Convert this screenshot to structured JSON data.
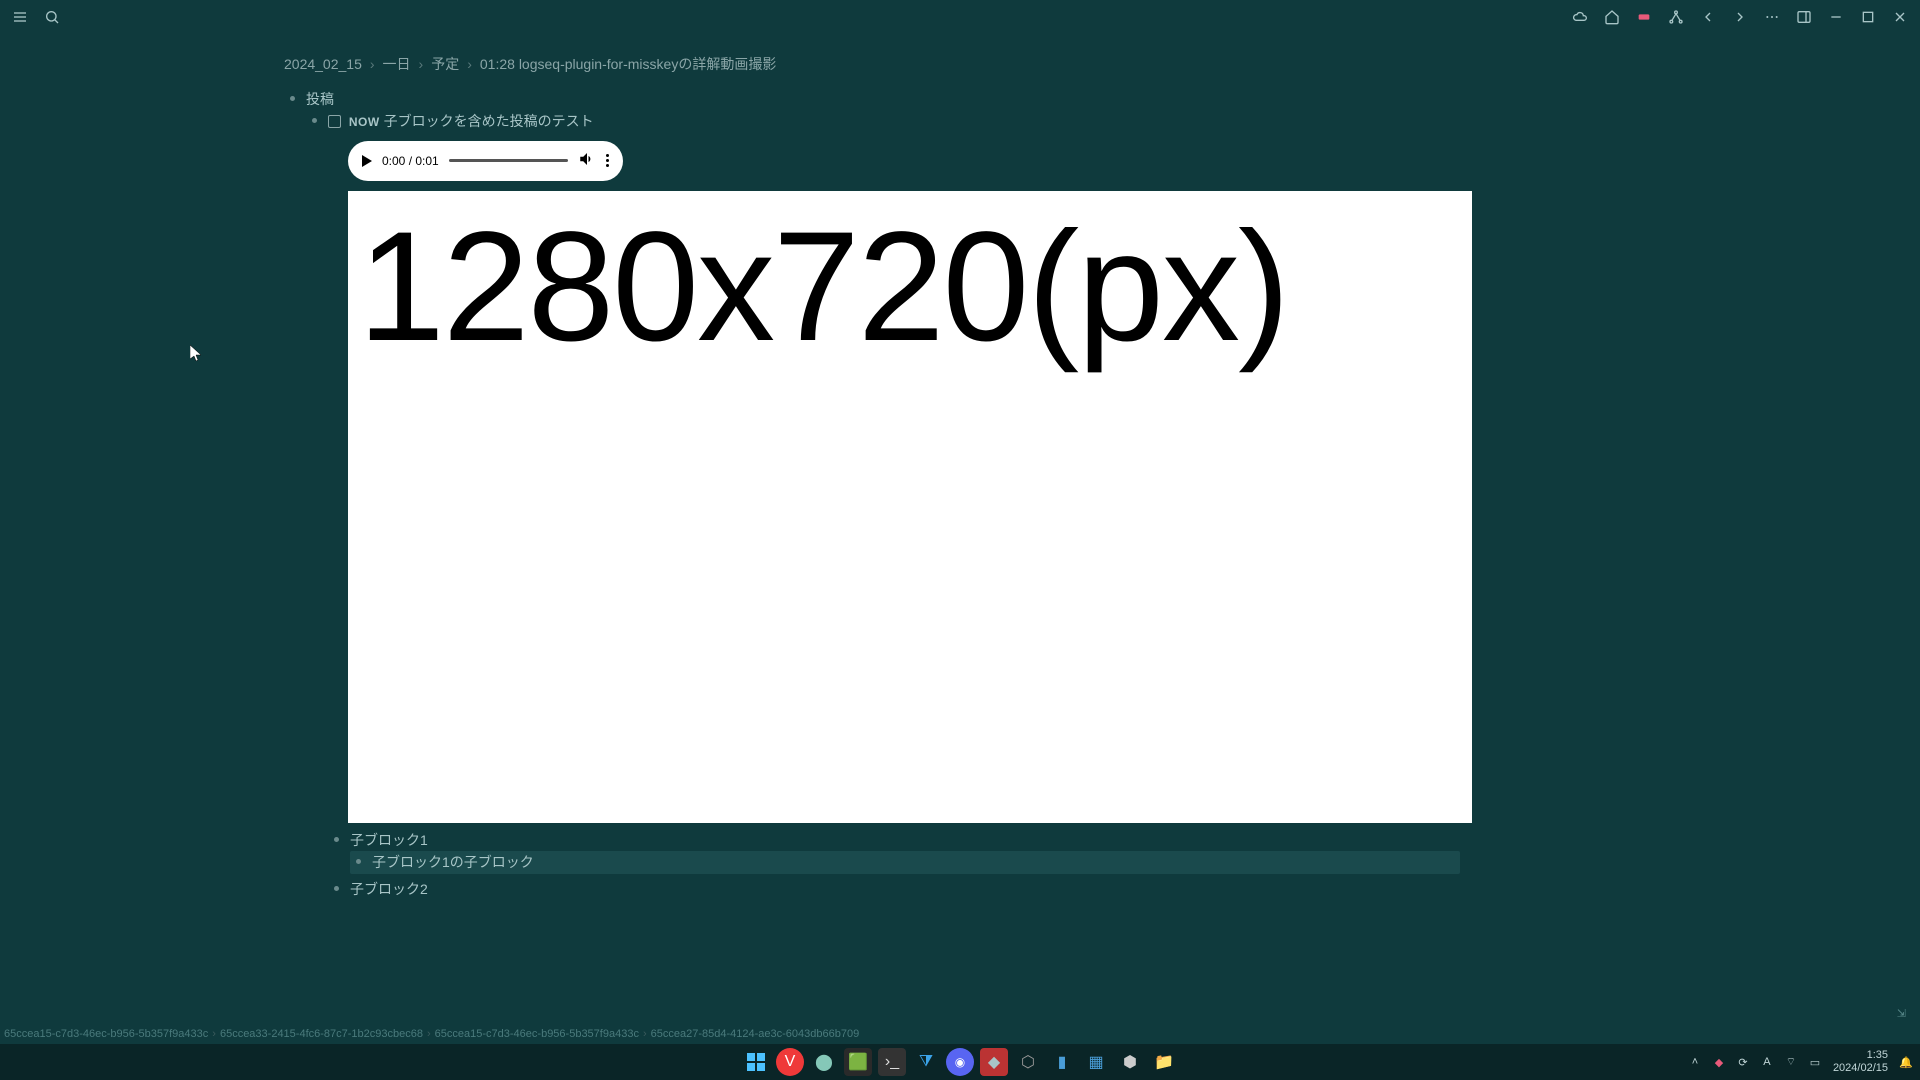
{
  "breadcrumbs": [
    {
      "label": "2024_02_15"
    },
    {
      "label": "一日"
    },
    {
      "label": "予定"
    },
    {
      "label": "01:28 logseq-plugin-for-misskeyの詳解動画撮影"
    }
  ],
  "blocks": {
    "root_label": "投稿",
    "task_now": "NOW",
    "task_label": "子ブロックを含めた投稿のテスト",
    "child1": "子ブロック1",
    "child1_child": "子ブロック1の子ブロック",
    "child2": "子ブロック2"
  },
  "audio": {
    "time_current": "0:00",
    "time_total": "0:01",
    "time_display": "0:00 / 0:01"
  },
  "image": {
    "text": "1280x720(px)"
  },
  "status_path": [
    "65ccea15-c7d3-46ec-b956-5b357f9a433c",
    "65ccea33-2415-4fc6-87c7-1b2c93cbec68",
    "65ccea15-c7d3-46ec-b956-5b357f9a433c",
    "65ccea27-85d4-4124-ae3c-6043db66b709"
  ],
  "taskbar": {
    "time": "1:35",
    "date": "2024/02/15",
    "ime": "A"
  }
}
